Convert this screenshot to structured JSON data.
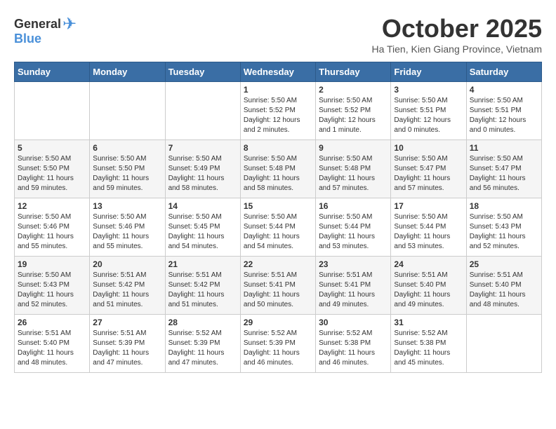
{
  "header": {
    "logo_general": "General",
    "logo_blue": "Blue",
    "month_title": "October 2025",
    "subtitle": "Ha Tien, Kien Giang Province, Vietnam"
  },
  "days_of_week": [
    "Sunday",
    "Monday",
    "Tuesday",
    "Wednesday",
    "Thursday",
    "Friday",
    "Saturday"
  ],
  "weeks": [
    [
      {
        "day": "",
        "info": ""
      },
      {
        "day": "",
        "info": ""
      },
      {
        "day": "",
        "info": ""
      },
      {
        "day": "1",
        "info": "Sunrise: 5:50 AM\nSunset: 5:52 PM\nDaylight: 12 hours\nand 2 minutes."
      },
      {
        "day": "2",
        "info": "Sunrise: 5:50 AM\nSunset: 5:52 PM\nDaylight: 12 hours\nand 1 minute."
      },
      {
        "day": "3",
        "info": "Sunrise: 5:50 AM\nSunset: 5:51 PM\nDaylight: 12 hours\nand 0 minutes."
      },
      {
        "day": "4",
        "info": "Sunrise: 5:50 AM\nSunset: 5:51 PM\nDaylight: 12 hours\nand 0 minutes."
      }
    ],
    [
      {
        "day": "5",
        "info": "Sunrise: 5:50 AM\nSunset: 5:50 PM\nDaylight: 11 hours\nand 59 minutes."
      },
      {
        "day": "6",
        "info": "Sunrise: 5:50 AM\nSunset: 5:50 PM\nDaylight: 11 hours\nand 59 minutes."
      },
      {
        "day": "7",
        "info": "Sunrise: 5:50 AM\nSunset: 5:49 PM\nDaylight: 11 hours\nand 58 minutes."
      },
      {
        "day": "8",
        "info": "Sunrise: 5:50 AM\nSunset: 5:48 PM\nDaylight: 11 hours\nand 58 minutes."
      },
      {
        "day": "9",
        "info": "Sunrise: 5:50 AM\nSunset: 5:48 PM\nDaylight: 11 hours\nand 57 minutes."
      },
      {
        "day": "10",
        "info": "Sunrise: 5:50 AM\nSunset: 5:47 PM\nDaylight: 11 hours\nand 57 minutes."
      },
      {
        "day": "11",
        "info": "Sunrise: 5:50 AM\nSunset: 5:47 PM\nDaylight: 11 hours\nand 56 minutes."
      }
    ],
    [
      {
        "day": "12",
        "info": "Sunrise: 5:50 AM\nSunset: 5:46 PM\nDaylight: 11 hours\nand 55 minutes."
      },
      {
        "day": "13",
        "info": "Sunrise: 5:50 AM\nSunset: 5:46 PM\nDaylight: 11 hours\nand 55 minutes."
      },
      {
        "day": "14",
        "info": "Sunrise: 5:50 AM\nSunset: 5:45 PM\nDaylight: 11 hours\nand 54 minutes."
      },
      {
        "day": "15",
        "info": "Sunrise: 5:50 AM\nSunset: 5:44 PM\nDaylight: 11 hours\nand 54 minutes."
      },
      {
        "day": "16",
        "info": "Sunrise: 5:50 AM\nSunset: 5:44 PM\nDaylight: 11 hours\nand 53 minutes."
      },
      {
        "day": "17",
        "info": "Sunrise: 5:50 AM\nSunset: 5:44 PM\nDaylight: 11 hours\nand 53 minutes."
      },
      {
        "day": "18",
        "info": "Sunrise: 5:50 AM\nSunset: 5:43 PM\nDaylight: 11 hours\nand 52 minutes."
      }
    ],
    [
      {
        "day": "19",
        "info": "Sunrise: 5:50 AM\nSunset: 5:43 PM\nDaylight: 11 hours\nand 52 minutes."
      },
      {
        "day": "20",
        "info": "Sunrise: 5:51 AM\nSunset: 5:42 PM\nDaylight: 11 hours\nand 51 minutes."
      },
      {
        "day": "21",
        "info": "Sunrise: 5:51 AM\nSunset: 5:42 PM\nDaylight: 11 hours\nand 51 minutes."
      },
      {
        "day": "22",
        "info": "Sunrise: 5:51 AM\nSunset: 5:41 PM\nDaylight: 11 hours\nand 50 minutes."
      },
      {
        "day": "23",
        "info": "Sunrise: 5:51 AM\nSunset: 5:41 PM\nDaylight: 11 hours\nand 49 minutes."
      },
      {
        "day": "24",
        "info": "Sunrise: 5:51 AM\nSunset: 5:40 PM\nDaylight: 11 hours\nand 49 minutes."
      },
      {
        "day": "25",
        "info": "Sunrise: 5:51 AM\nSunset: 5:40 PM\nDaylight: 11 hours\nand 48 minutes."
      }
    ],
    [
      {
        "day": "26",
        "info": "Sunrise: 5:51 AM\nSunset: 5:40 PM\nDaylight: 11 hours\nand 48 minutes."
      },
      {
        "day": "27",
        "info": "Sunrise: 5:51 AM\nSunset: 5:39 PM\nDaylight: 11 hours\nand 47 minutes."
      },
      {
        "day": "28",
        "info": "Sunrise: 5:52 AM\nSunset: 5:39 PM\nDaylight: 11 hours\nand 47 minutes."
      },
      {
        "day": "29",
        "info": "Sunrise: 5:52 AM\nSunset: 5:39 PM\nDaylight: 11 hours\nand 46 minutes."
      },
      {
        "day": "30",
        "info": "Sunrise: 5:52 AM\nSunset: 5:38 PM\nDaylight: 11 hours\nand 46 minutes."
      },
      {
        "day": "31",
        "info": "Sunrise: 5:52 AM\nSunset: 5:38 PM\nDaylight: 11 hours\nand 45 minutes."
      },
      {
        "day": "",
        "info": ""
      }
    ]
  ]
}
